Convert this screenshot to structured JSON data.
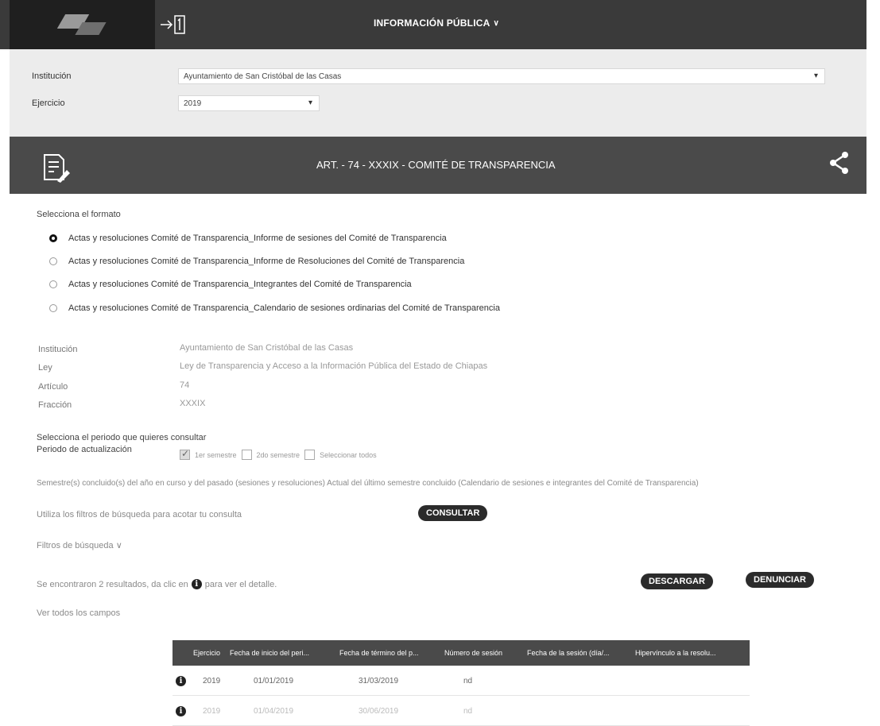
{
  "nav": {
    "title": "INFORMACIÓN PÚBLICA",
    "chevron": "∨"
  },
  "selectors": {
    "institution_label": "Institución",
    "institution_value": "Ayuntamiento de San Cristóbal de las Casas",
    "year_label": "Ejercicio",
    "year_value": "2019"
  },
  "banner": {
    "title": "ART. - 74 - XXXIX - COMITÉ DE TRANSPARENCIA",
    "icons": [
      "document-edit-icon",
      "share-icon"
    ]
  },
  "format": {
    "heading": "Selecciona el formato",
    "options": [
      {
        "label": "Actas y resoluciones Comité de Transparencia_Informe de sesiones del Comité de Transparencia",
        "checked": true
      },
      {
        "label": "Actas y resoluciones Comité de Transparencia_Informe de Resoluciones del Comité de Transparencia",
        "checked": false
      },
      {
        "label": "Actas y resoluciones Comité de Transparencia_Integrantes del Comité de Transparencia",
        "checked": false
      },
      {
        "label": "Actas y resoluciones Comité de Transparencia_Calendario de sesiones ordinarias del Comité de Transparencia",
        "checked": false
      }
    ]
  },
  "info": {
    "institution_label": "Institución",
    "institution_value": "Ayuntamiento de San Cristóbal de las Casas",
    "law_label": "Ley",
    "law_value": "Ley de Transparencia y Acceso a la Información Pública del Estado de Chiapas",
    "article_label": "Artículo",
    "article_value": "74",
    "fraction_label": "Fracción",
    "fraction_value": "XXXIX"
  },
  "period": {
    "heading": "Selecciona el periodo que quieres consultar",
    "label": "Periodo de actualización",
    "options": [
      {
        "label": "1er semestre",
        "checked": true
      },
      {
        "label": "2do semestre",
        "checked": false
      },
      {
        "label": "Seleccionar todos",
        "checked": false
      }
    ],
    "note": "Semestre(s) concluido(s) del año en curso y del pasado (sesiones y resoluciones) Actual del último semestre concluido (Calendario de sesiones e integrantes del Comité de Transparencia)"
  },
  "search": {
    "hint": "Utiliza los filtros de búsqueda para acotar tu consulta",
    "consult_button": "CONSULTAR",
    "filters_label": "Filtros de búsqueda",
    "filters_chevron": "∨"
  },
  "results": {
    "prefix": "Se encontraron 2 resultados, da clic en",
    "suffix": "para ver el detalle.",
    "download_button": "DESCARGAR",
    "report_button": "DENUNCIAR",
    "view_all": "Ver todos los campos",
    "info_glyph": "i"
  },
  "table": {
    "columns": [
      "Ejercicio",
      "Fecha de inicio del peri...",
      "Fecha de término del p...",
      "Número de sesión",
      "Fecha de la sesión (día/...",
      "Hipervínculo a la resolu..."
    ],
    "rows": [
      [
        "2019",
        "01/01/2019",
        "31/03/2019",
        "nd"
      ],
      [
        "2019",
        "01/04/2019",
        "30/06/2019",
        "nd"
      ]
    ]
  }
}
